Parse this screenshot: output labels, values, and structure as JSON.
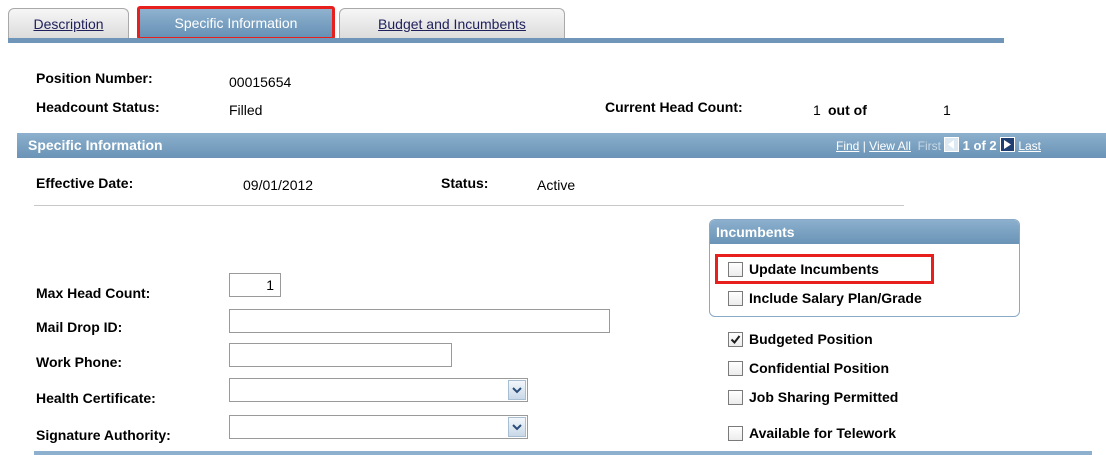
{
  "tabs": [
    {
      "label": "Description",
      "active": false
    },
    {
      "label": "Specific Information",
      "active": true
    },
    {
      "label": "Budget and Incumbents",
      "active": false
    }
  ],
  "header": {
    "position_number_label": "Position Number:",
    "position_number_value": "00015654",
    "headcount_status_label": "Headcount Status:",
    "headcount_status_value": "Filled",
    "current_head_count_label": "Current Head Count:",
    "current_head_count_value": "1",
    "out_of_label": "out of",
    "out_of_value": "1"
  },
  "section": {
    "title": "Specific Information",
    "nav": {
      "find": "Find",
      "separator": "|",
      "view_all": "View All",
      "first": "First",
      "count": "1 of 2",
      "last": "Last"
    }
  },
  "effective": {
    "date_label": "Effective Date:",
    "date_value": "09/01/2012",
    "status_label": "Status:",
    "status_value": "Active"
  },
  "incumbents": {
    "title": "Incumbents",
    "update": {
      "label": "Update Incumbents",
      "checked": false
    },
    "include_salary": {
      "label": "Include Salary Plan/Grade",
      "checked": false
    }
  },
  "fields": {
    "max_head_count_label": "Max Head Count:",
    "max_head_count_value": "1",
    "mail_drop_label": "Mail Drop ID:",
    "mail_drop_value": "",
    "work_phone_label": "Work Phone:",
    "work_phone_value": "",
    "health_cert_label": "Health Certificate:",
    "health_cert_value": "",
    "signature_label": "Signature Authority:",
    "signature_value": ""
  },
  "checkboxes": {
    "budgeted": {
      "label": "Budgeted Position",
      "checked": true
    },
    "confidential": {
      "label": "Confidential Position",
      "checked": false
    },
    "job_sharing": {
      "label": "Job Sharing Permitted",
      "checked": false
    },
    "telework": {
      "label": "Available for Telework",
      "checked": false
    }
  },
  "colors": {
    "accent_blue": "#6f95b8",
    "highlight_red": "#e8201d",
    "link_color": "#1f1f5c"
  }
}
